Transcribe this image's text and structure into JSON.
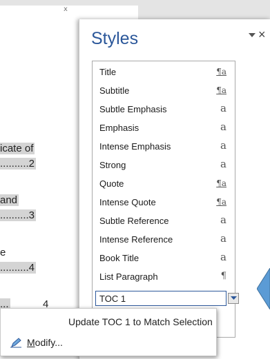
{
  "document": {
    "top_mark": "x",
    "lines": [
      {
        "text": "icate of",
        "highlight": true
      },
      {
        "text": "..........2",
        "highlight": true
      },
      {
        "text": "and",
        "highlight": true
      },
      {
        "text": "..........3",
        "highlight": true
      },
      {
        "text": "e",
        "highlight": false
      },
      {
        "text": "..........4",
        "highlight": true
      },
      {
        "text": "...",
        "highlight": true
      },
      {
        "text": "4",
        "highlight": false
      }
    ]
  },
  "pane": {
    "title": "Styles",
    "dropdown_icon": "triangle-down-icon",
    "close_label": "×",
    "accent_color": "#2b579a"
  },
  "styles": [
    {
      "name": "Title",
      "type": "linked",
      "glyph": "¶a"
    },
    {
      "name": "Subtitle",
      "type": "linked",
      "glyph": "¶a"
    },
    {
      "name": "Subtle Emphasis",
      "type": "character",
      "glyph": "a"
    },
    {
      "name": "Emphasis",
      "type": "character",
      "glyph": "a"
    },
    {
      "name": "Intense Emphasis",
      "type": "character",
      "glyph": "a"
    },
    {
      "name": "Strong",
      "type": "character",
      "glyph": "a"
    },
    {
      "name": "Quote",
      "type": "linked",
      "glyph": "¶a"
    },
    {
      "name": "Intense Quote",
      "type": "linked",
      "glyph": "¶a"
    },
    {
      "name": "Subtle Reference",
      "type": "character",
      "glyph": "a"
    },
    {
      "name": "Intense Reference",
      "type": "character",
      "glyph": "a"
    },
    {
      "name": "Book Title",
      "type": "character",
      "glyph": "a"
    },
    {
      "name": "List Paragraph",
      "type": "paragraph",
      "glyph": "¶"
    },
    {
      "name": "TOC 1",
      "type": "selected",
      "glyph": ""
    }
  ],
  "context_menu": {
    "update": {
      "prefix": "Update TOC 1 to Match Selection"
    },
    "modify": {
      "underlined": "M",
      "rest": "odify...",
      "icon": "pencil-icon"
    }
  }
}
